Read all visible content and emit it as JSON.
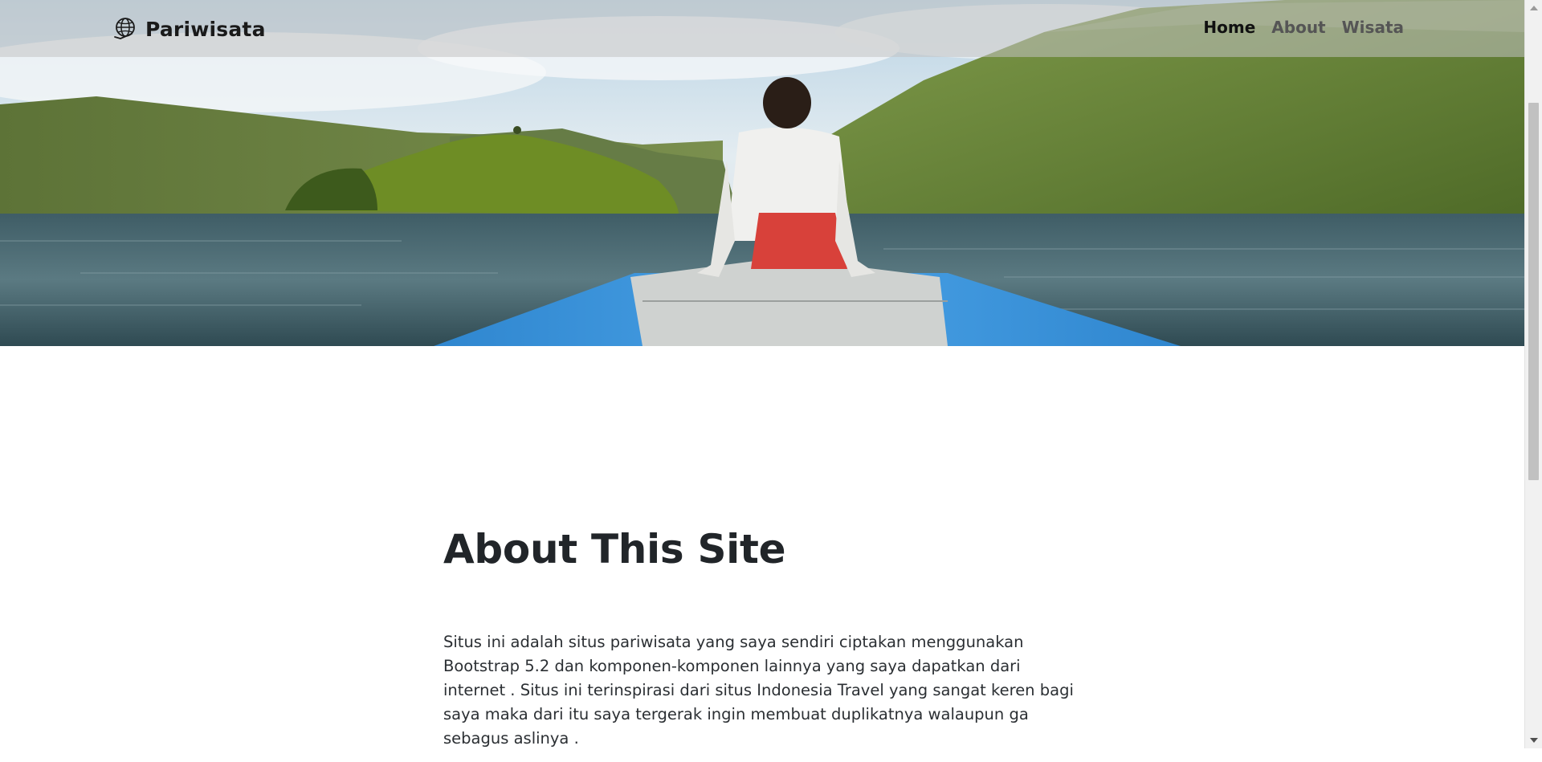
{
  "navbar": {
    "brand": "Pariwisata",
    "brand_icon": "globe-icon",
    "links": [
      {
        "label": "Home",
        "active": true
      },
      {
        "label": "About",
        "active": false
      },
      {
        "label": "Wisata",
        "active": false
      }
    ]
  },
  "hero": {
    "image": "lake-boat-mountains-photo"
  },
  "about": {
    "title": "About This Site",
    "paragraphs": [
      "Situs ini adalah situs pariwisata yang saya sendiri ciptakan menggunakan Bootstrap 5.2 dan komponen-komponen lainnya yang saya dapatkan dari internet . Situs ini terinspirasi dari situs Indonesia Travel yang sangat keren bagi saya maka dari itu saya tergerak ingin membuat duplikatnya walaupun ga sebagus aslinya ."
    ]
  },
  "colors": {
    "nav_text": "#555555",
    "nav_active": "#111111",
    "boat_blue": "#3a8fd1",
    "water": "#4a6b73",
    "hills": "#6f8f3a"
  }
}
